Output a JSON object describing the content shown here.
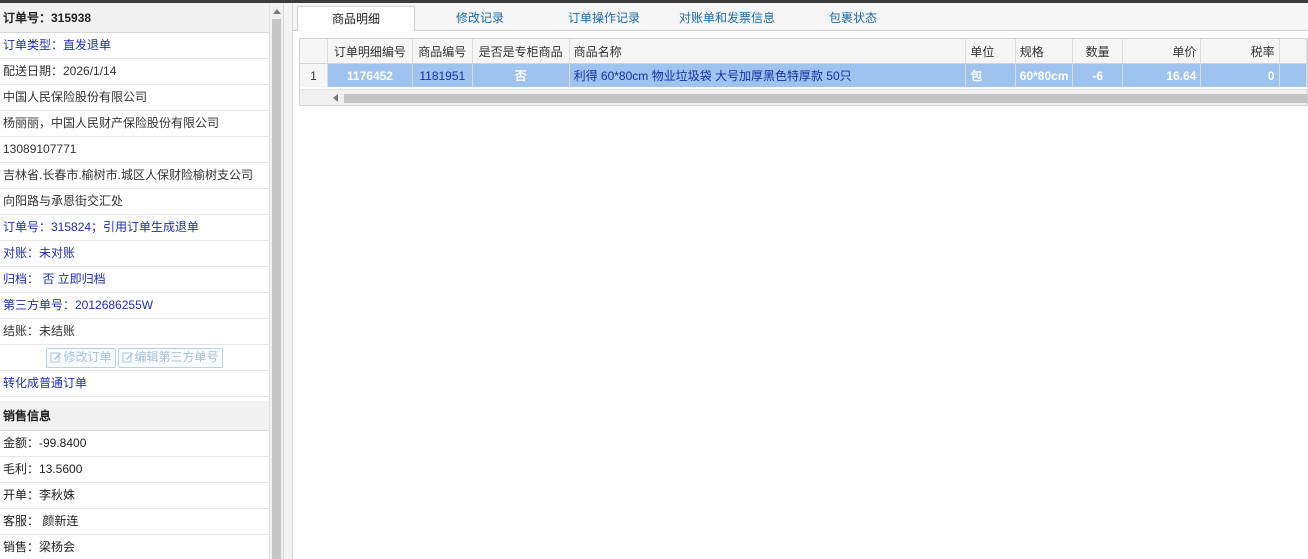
{
  "order": {
    "title": "订单号：315938",
    "rows": [
      {
        "text": "订单类型：直发退单",
        "style": "blue"
      },
      {
        "text": "配送日期：2026/1/14",
        "style": "dark"
      },
      {
        "text": "中国人民保险股份有限公司",
        "style": "dark"
      },
      {
        "text": "杨丽丽，中国人民财产保险股份有限公司",
        "style": "dark"
      },
      {
        "text": "13089107771",
        "style": "dark"
      },
      {
        "text": "吉林省.长春市.榆树市.城区人保财险榆树支公司",
        "style": "dark"
      },
      {
        "text": "向阳路与承恩街交汇处",
        "style": "dark"
      },
      {
        "text": "订单号：315824；引用订单生成退单",
        "style": "blue"
      },
      {
        "text": "对账：未对账",
        "style": "blue"
      },
      {
        "text": "归档： 否 立即归档",
        "style": "blue"
      },
      {
        "text": "第三方单号：2012686255W",
        "style": "blue"
      },
      {
        "text": "结账：未结账",
        "style": "dark"
      }
    ],
    "edit_order_button": "修改订单",
    "edit_third_party_button": "编辑第三方单号",
    "convert_link": "转化成普通订单"
  },
  "sales": {
    "title": "销售信息",
    "rows": [
      "金额：-99.8400",
      "毛利：13.5600",
      "开单：李秋姝",
      "客服： 颜新连",
      "销售：梁杨会"
    ]
  },
  "tabs": [
    "商品明细",
    "修改记录",
    "订单操作记录",
    "对账单和发票信息",
    "包裹状态"
  ],
  "grid": {
    "columns": [
      "订单明细编号",
      "商品编号",
      "是否是专柜商品",
      "商品名称",
      "单位",
      "规格",
      "数量",
      "单价",
      "税率"
    ],
    "rows": [
      {
        "row_number": "1",
        "detail_id": "1176452",
        "product_id": "1181951",
        "is_counter": "否",
        "name": "利得 60*80cm 物业垃圾袋 大号加厚黑色特厚款 50只",
        "unit": "包",
        "spec": "60*80cm",
        "quantity": "-6",
        "unit_price": "16.64",
        "tax_rate": "0"
      }
    ]
  },
  "colors": {
    "selected_row": "#9ec3ee",
    "link_blue": "#1f2fa8",
    "tab_blue": "#1f6aa5"
  }
}
